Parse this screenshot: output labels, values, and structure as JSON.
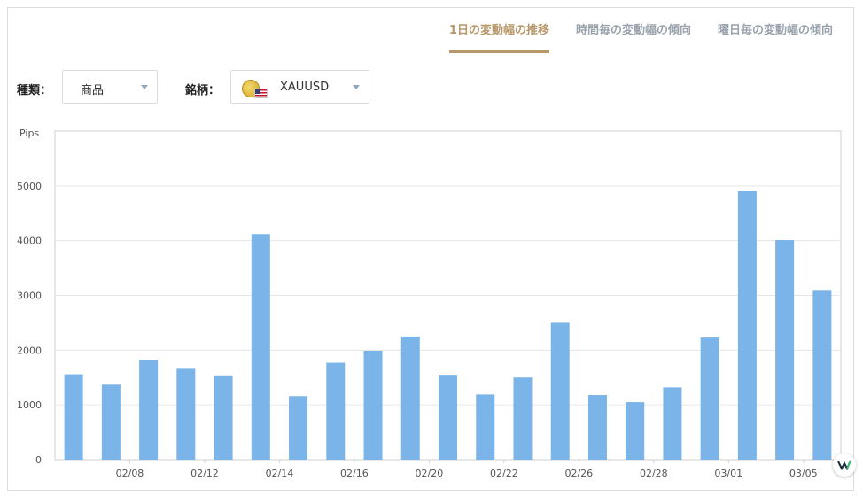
{
  "tabs": [
    {
      "label": "1日の変動幅の推移",
      "active": true
    },
    {
      "label": "時間毎の変動幅の傾向",
      "active": false
    },
    {
      "label": "曜日毎の変動幅の傾向",
      "active": false
    }
  ],
  "filters": {
    "type_label": "種類：",
    "type_value": "商品",
    "symbol_label": "銘柄：",
    "symbol_value": "XAUUSD"
  },
  "colors": {
    "bar": "#7ab4e8",
    "accent": "#b8986b",
    "tab_inactive": "#9aa3ad"
  },
  "chart_data": {
    "type": "bar",
    "ylabel": "Pips",
    "ylim": [
      0,
      6000
    ],
    "yticks": [
      0,
      1000,
      2000,
      3000,
      4000,
      5000
    ],
    "grid": true,
    "values": [
      1560,
      1370,
      1820,
      1660,
      1540,
      4120,
      1160,
      1770,
      1990,
      2250,
      1550,
      1190,
      1500,
      2500,
      1180,
      1050,
      1320,
      2230,
      4900,
      4010,
      3100
    ],
    "xtick_labels": [
      {
        "bar": 1.5,
        "label": "02/08"
      },
      {
        "bar": 3.5,
        "label": "02/12"
      },
      {
        "bar": 5.5,
        "label": "02/14"
      },
      {
        "bar": 7.5,
        "label": "02/16"
      },
      {
        "bar": 9.5,
        "label": "02/20"
      },
      {
        "bar": 11.5,
        "label": "02/22"
      },
      {
        "bar": 13.5,
        "label": "02/26"
      },
      {
        "bar": 15.5,
        "label": "02/28"
      },
      {
        "bar": 17.5,
        "label": "03/01"
      },
      {
        "bar": 19.5,
        "label": "03/05"
      }
    ]
  }
}
